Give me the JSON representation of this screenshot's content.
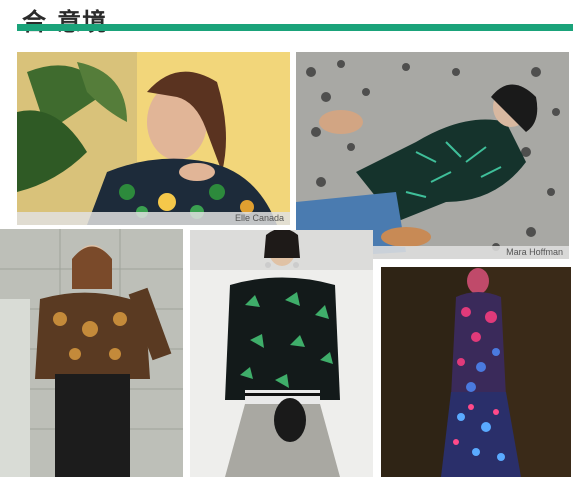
{
  "page": {
    "title": "合.意境",
    "accent_color": "#1aa37a"
  },
  "photos": [
    {
      "id": "photo-1",
      "caption": "Elle Canada",
      "subject": "model in tropical print blouse with palm leaves"
    },
    {
      "id": "photo-2",
      "caption": "Mara Hoffman",
      "subject": "model lying on leopard rug in green leaf print shirt"
    },
    {
      "id": "photo-3",
      "caption": "",
      "subject": "model in metallic leaf print sheer top in subway"
    },
    {
      "id": "photo-4",
      "caption": "",
      "subject": "model in black palm print shirt and silver skirt"
    },
    {
      "id": "photo-5",
      "caption": "",
      "subject": "model in sequined floral dress under neon light"
    }
  ]
}
